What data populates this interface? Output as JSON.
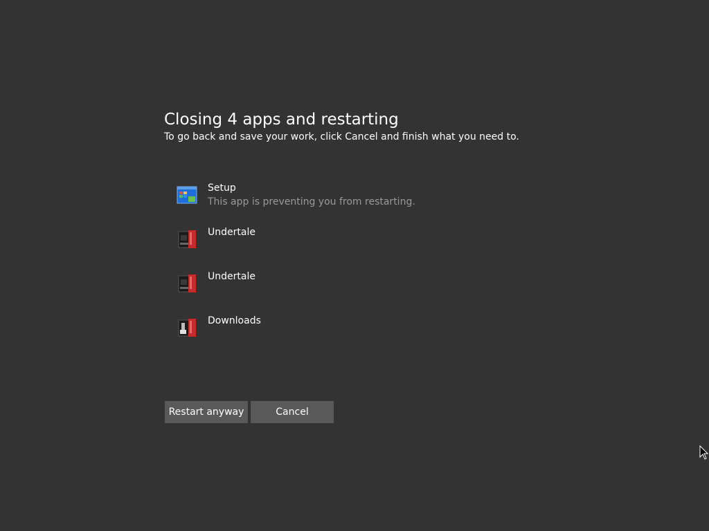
{
  "dialog": {
    "title": "Closing 4 apps and restarting",
    "subtitle": "To go back and save your work, click Cancel and finish what you need to."
  },
  "apps": [
    {
      "name": "Setup",
      "description": "This app is preventing you from restarting.",
      "icon": "setup-window-icon"
    },
    {
      "name": "Undertale",
      "description": "",
      "icon": "undertale-icon"
    },
    {
      "name": "Undertale",
      "description": "",
      "icon": "undertale-icon"
    },
    {
      "name": "Downloads",
      "description": "",
      "icon": "downloads-icon"
    }
  ],
  "buttons": {
    "restart_label": "Restart anyway",
    "cancel_label": "Cancel"
  },
  "colors": {
    "background": "#333333",
    "button": "#595959",
    "secondary_text": "#9a9a9a",
    "icon_blue": "#1e6fd9",
    "icon_red": "#c62a2a"
  }
}
